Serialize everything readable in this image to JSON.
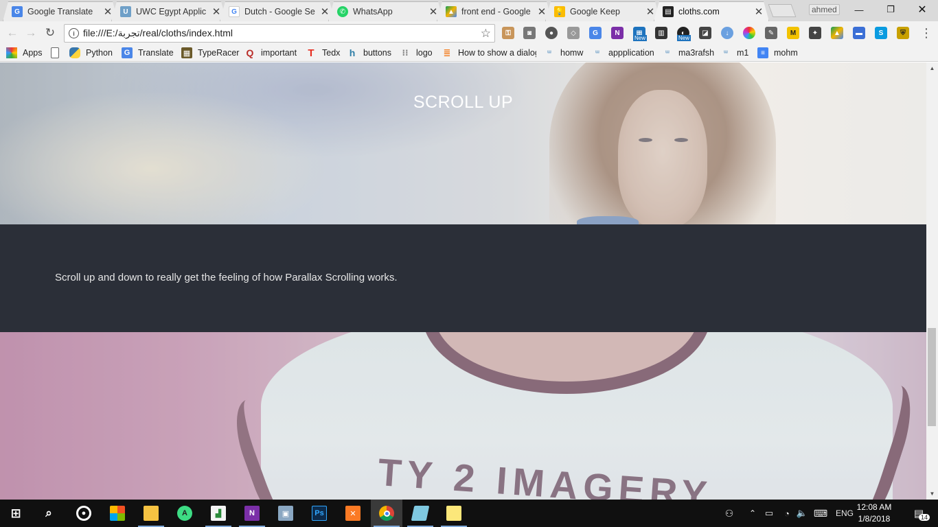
{
  "browser": {
    "tabs": [
      {
        "title": "Google Translate",
        "favicon": "google-translate-icon",
        "color": "#4a86e8"
      },
      {
        "title": "UWC Egypt Applic",
        "favicon": "uwc-icon",
        "color": "#6fa0c8"
      },
      {
        "title": "Dutch - Google Se",
        "favicon": "google-icon",
        "color": "#4285f4"
      },
      {
        "title": "WhatsApp",
        "favicon": "whatsapp-icon",
        "color": "#25d366"
      },
      {
        "title": "front end - Google",
        "favicon": "google-drive-icon",
        "color": "#f4b400"
      },
      {
        "title": "Google Keep",
        "favicon": "google-keep-icon",
        "color": "#fbbc04"
      },
      {
        "title": "cloths.com",
        "favicon": "site-icon",
        "color": "#222222"
      }
    ],
    "profile_name": "ahmed",
    "url": "file:///E:/تجربة/real/cloths/index.html",
    "bookmarks": [
      {
        "label": "Apps",
        "icon": "apps-grid-icon"
      },
      {
        "label": "",
        "icon": "page-icon"
      },
      {
        "label": "Python",
        "icon": "python-icon"
      },
      {
        "label": "Translate",
        "icon": "translate-icon"
      },
      {
        "label": "TypeRacer",
        "icon": "typeracer-icon"
      },
      {
        "label": "important",
        "icon": "quora-icon"
      },
      {
        "label": "Tedx",
        "icon": "tedx-icon"
      },
      {
        "label": "buttons",
        "icon": "hm-icon"
      },
      {
        "label": "logo",
        "icon": "dots-grid-icon"
      },
      {
        "label": "How to show a dialog",
        "icon": "stackoverflow-icon"
      },
      {
        "label": "homw",
        "icon": "uwc-icon"
      },
      {
        "label": "appplication",
        "icon": "uwc-icon"
      },
      {
        "label": "ma3rafsh",
        "icon": "uwc-icon"
      },
      {
        "label": "m1",
        "icon": "uwc-icon"
      },
      {
        "label": "mohm",
        "icon": "docs-icon"
      }
    ],
    "extension_badges": [
      "New",
      "New"
    ]
  },
  "page": {
    "hero_title": "SCROLL UP",
    "body_text": "Scroll up and down to really get the feeling of how Parallax Scrolling works.",
    "image_text": "TY 2 IMAGERY"
  },
  "taskbar": {
    "language": "ENG",
    "time": "12:08 AM",
    "date": "1/8/2018",
    "notification_count": "14"
  }
}
